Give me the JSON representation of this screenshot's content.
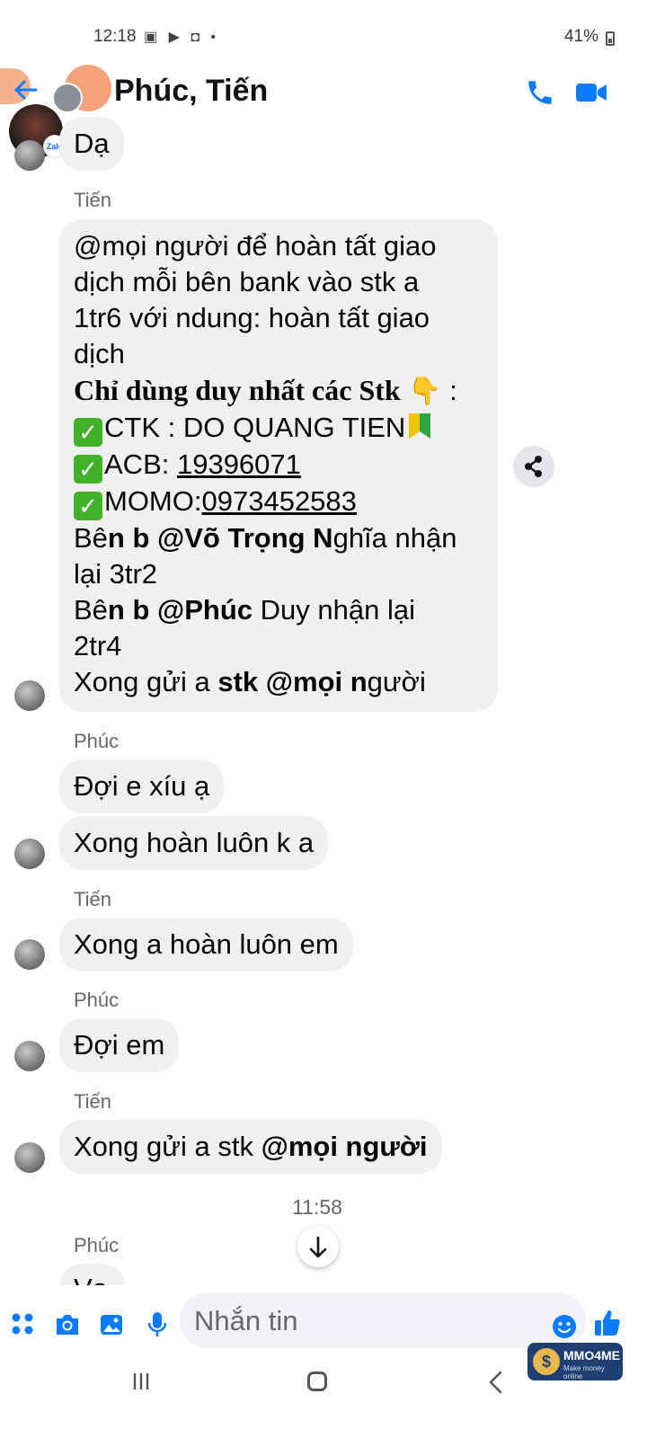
{
  "status_bar": {
    "time": "12:18",
    "notif_icons": "▣ ▶ ◘ •",
    "right_text": "41%"
  },
  "header": {
    "title": "Phúc, Tiến",
    "zalo_label": "Zalo"
  },
  "messages": {
    "m1": "Dạ",
    "s1": "Tiến",
    "m2": {
      "l1": "@mọi người để hoàn tất giao",
      "l2": "dịch mỗi bên bank vào stk a",
      "l3": "1tr6 với ndung: hoàn tất giao",
      "l4": "dịch",
      "l5": "Chỉ dùng duy nhất các Stk",
      "l5_hand": "👇",
      "l5_colon": " :",
      "l6": "CTK : DO QUANG TIEN",
      "l7_prefix": "ACB: ",
      "l7_num": "19396071",
      "l8_prefix": "MOMO:",
      "l8_num": "0973452583",
      "l9_a": "Bê",
      "l9_b": "n b @Võ Trọng N",
      "l9_c": "ghĩa nhận",
      "l10": "lại 3tr2",
      "l11_a": "Bê",
      "l11_b": "n b @Phúc",
      "l11_c": " Duy nhận lại",
      "l12": "2tr4",
      "l13_a": "Xong gửi a ",
      "l13_b": "stk @mọi n",
      "l13_c": "gười",
      "check": "✓"
    },
    "s2": "Phúc",
    "m3": "Đợi e xíu ạ",
    "m4": "Xong hoàn luôn k a",
    "s3": "Tiến",
    "m5": "Xong a hoàn luôn em",
    "s4": "Phúc",
    "m6": "Đợi em",
    "s5": "Tiến",
    "m7_a": "Xong gửi a stk ",
    "m7_b": "@mọi người",
    "time_sep": "11:58",
    "s6": "Phúc",
    "m8_partial": "Vạ"
  },
  "composer": {
    "placeholder": "Nhắn tin"
  },
  "watermark": {
    "coin": "$",
    "title": "MMO4ME",
    "subtitle": "Make money online"
  },
  "colors": {
    "accent": "#0a7cff",
    "bubble": "#f0f0f0",
    "secondary_text": "#65676b"
  }
}
